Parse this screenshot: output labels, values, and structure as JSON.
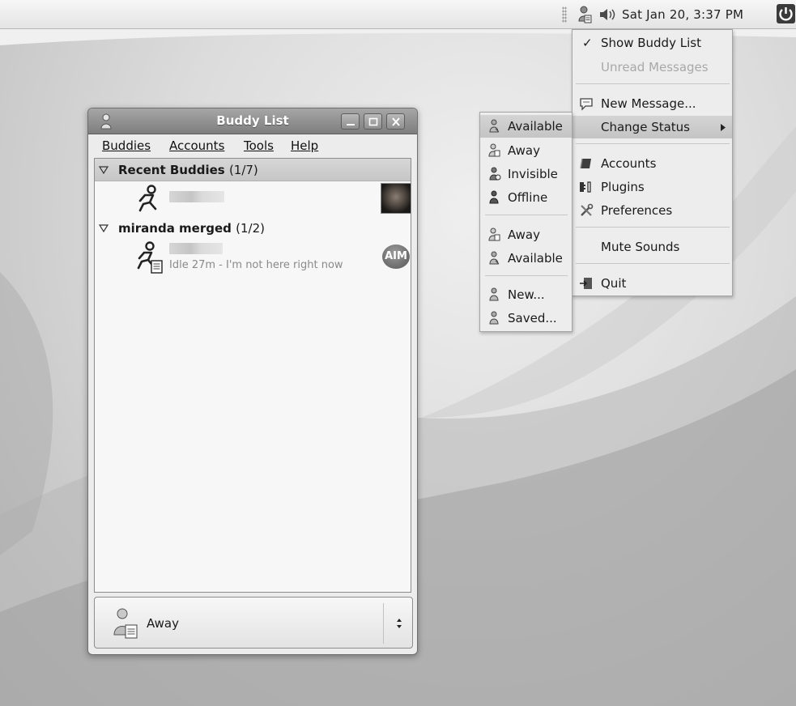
{
  "panel": {
    "clock": "Sat Jan 20,  3:37 PM"
  },
  "window": {
    "title": "Buddy List",
    "menu": {
      "buddies": "Buddies",
      "accounts": "Accounts",
      "tools": "Tools",
      "help": "Help"
    },
    "groups": [
      {
        "name": "Recent Buddies",
        "count": "(1/7)"
      },
      {
        "name": "miranda merged",
        "count": "(1/2)"
      }
    ],
    "buddies": [
      {
        "status_text": ""
      },
      {
        "status_text": "Idle 27m - I'm not here right now",
        "protocol_badge": "AIM"
      }
    ],
    "status_selector": {
      "current": "Away"
    }
  },
  "tray_menu": {
    "items": [
      {
        "label": "Show Buddy List",
        "checked": true
      },
      {
        "label": "Unread Messages",
        "disabled": true
      },
      {
        "label": "New Message..."
      },
      {
        "label": "Change Status",
        "highlighted": true
      },
      {
        "label": "Accounts"
      },
      {
        "label": "Plugins"
      },
      {
        "label": "Preferences"
      },
      {
        "label": "Mute Sounds"
      },
      {
        "label": "Quit"
      }
    ]
  },
  "status_submenu": {
    "items": [
      {
        "label": "Available",
        "highlighted": true
      },
      {
        "label": "Away"
      },
      {
        "label": "Invisible"
      },
      {
        "label": "Offline"
      },
      {
        "label": "Away"
      },
      {
        "label": "Available"
      },
      {
        "label": "New..."
      },
      {
        "label": "Saved..."
      }
    ]
  },
  "icons": {
    "tray": [
      "pidgin-tray-icon",
      "volume-icon",
      "power-icon"
    ],
    "check_glyph": "✓"
  }
}
